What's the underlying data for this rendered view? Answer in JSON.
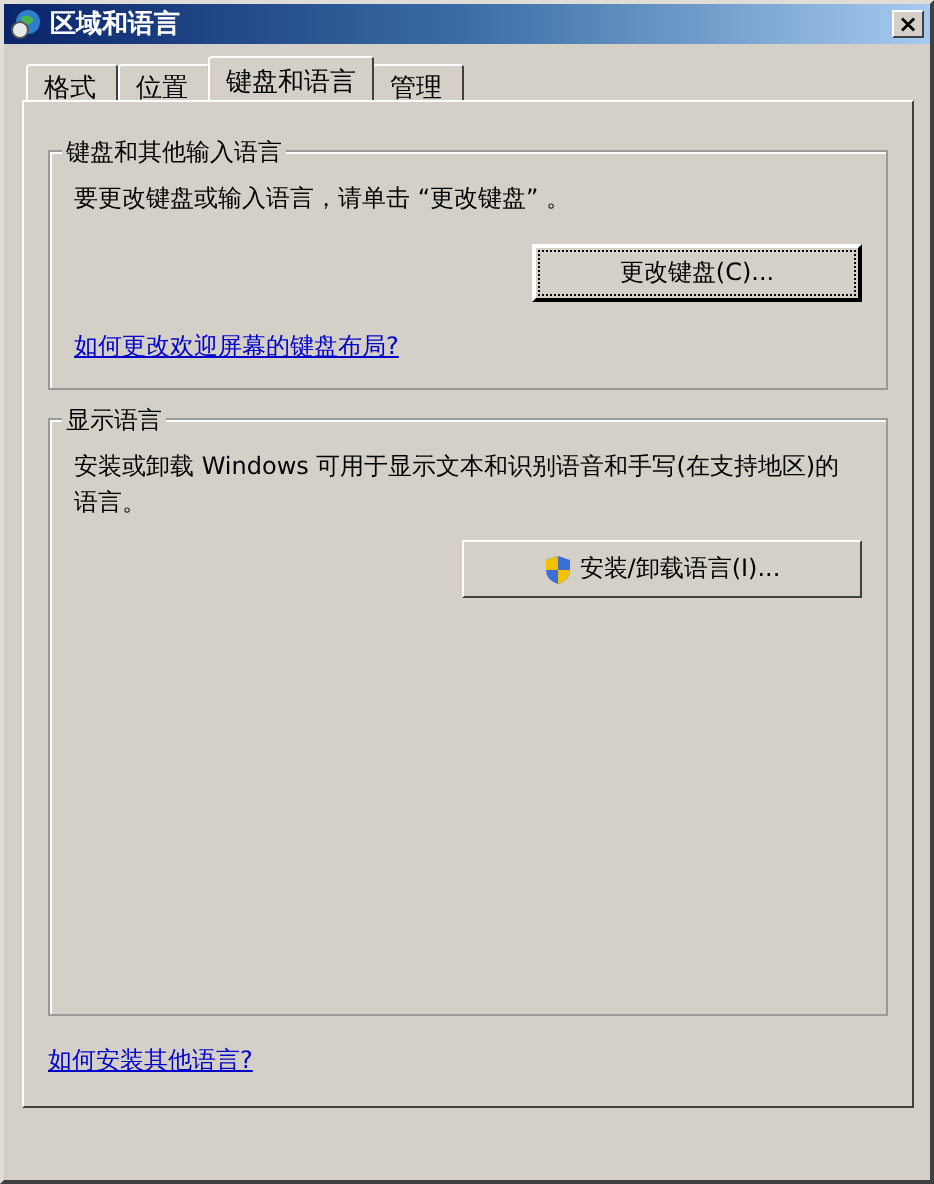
{
  "window": {
    "title": "区域和语言",
    "close": "×"
  },
  "tabs": [
    {
      "label": "格式",
      "selected": false
    },
    {
      "label": "位置",
      "selected": false
    },
    {
      "label": "键盘和语言",
      "selected": true
    },
    {
      "label": "管理",
      "selected": false
    }
  ],
  "groups": [
    {
      "title": "键盘和其他输入语言",
      "text": "要更改键盘或输入语言，请单击 “更改键盘” 。",
      "button": {
        "label": "更改键盘(C)...",
        "focused": true,
        "shield": false
      },
      "link": "如何更改欢迎屏幕的键盘布局?"
    },
    {
      "title": "显示语言",
      "text": "安装或卸载 Windows 可用于显示文本和识别语音和手写(在支持地区)的语言。",
      "button": {
        "label": "安装/卸载语言(I)...",
        "focused": false,
        "shield": true
      }
    }
  ],
  "footer_link": "如何安装其他语言?"
}
